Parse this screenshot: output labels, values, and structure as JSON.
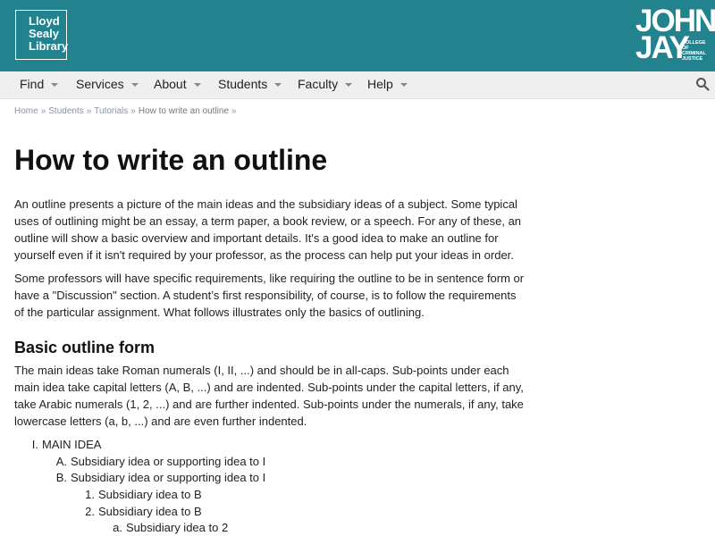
{
  "header": {
    "library_logo_lines": [
      "Lloyd",
      "Sealy",
      "Library"
    ],
    "college_logo_words": [
      "JOHN",
      "JAY"
    ],
    "college_logo_sub": [
      "COLLEGE",
      "OF",
      "CRIMINAL",
      "JUSTICE"
    ],
    "bg_color": "#22838f"
  },
  "nav": {
    "items": [
      {
        "label": "Find"
      },
      {
        "label": "Services"
      },
      {
        "label": "About"
      },
      {
        "label": "Students"
      },
      {
        "label": "Faculty"
      },
      {
        "label": "Help"
      }
    ],
    "search_icon": "search-icon"
  },
  "breadcrumb": {
    "items": [
      "Home",
      "Students",
      "Tutorials"
    ],
    "current": "How to write an outline",
    "separator": "»"
  },
  "page": {
    "title": "How to write an outline",
    "intro_1": "An outline presents a picture of the main ideas and the subsidiary ideas of a subject. Some typical uses of outlining might be an essay, a term paper, a book review, or a speech. For any of these, an outline will show a basic overview and important details. It's a good idea to make an outline for yourself even if it isn't required by your professor, as the process can help put your ideas in order.",
    "intro_2": "Some professors will have specific requirements, like requiring the outline to be in sentence form or have a \"Discussion\" section. A student’s first responsibility, of course, is to follow the requirements of the particular assignment. What follows illustrates only the basics of outlining.",
    "section_heading": "Basic outline form",
    "section_text": "The main ideas take Roman numerals (I, II, ...) and should be in all-caps. Sub-points under each main idea take capital letters (A, B, ...) and are indented. Sub-points under the capital letters, if any, take Arabic numerals (1, 2, ...) and are further indented. Sub-points under the numerals, if any, take lowercase letters (a, b, ...) and are even further indented."
  },
  "outline": [
    {
      "marker": "I.",
      "text": "MAIN IDEA"
    },
    {
      "marker": "A.",
      "text": "Subsidiary idea or supporting idea to I"
    },
    {
      "marker": "B.",
      "text": "Subsidiary idea or supporting idea to I"
    },
    {
      "marker": "1.",
      "text": "Subsidiary idea to B"
    },
    {
      "marker": "2.",
      "text": "Subsidiary idea to B"
    },
    {
      "marker": "a.",
      "text": "Subsidiary idea to 2"
    }
  ]
}
